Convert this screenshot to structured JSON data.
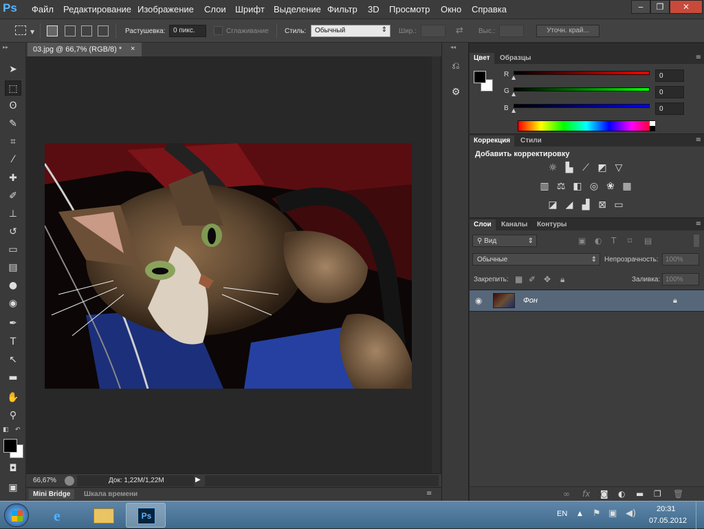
{
  "app": {
    "logo": "Ps"
  },
  "menu": [
    "Файл",
    "Редактирование",
    "Изображение",
    "Слои",
    "Шрифт",
    "Выделение",
    "Фильтр",
    "3D",
    "Просмотр",
    "Окно",
    "Справка"
  ],
  "window_buttons": {
    "minimize": "‒",
    "restore": "❐",
    "close": "✕"
  },
  "options": {
    "feather_label": "Растушевка:",
    "feather_value": "0 пикс.",
    "antialias_label": "Сглаживание",
    "style_label": "Стиль:",
    "style_value": "Обычный",
    "width_label": "Шир.:",
    "height_label": "Выс.:",
    "refine_button": "Уточн. край..."
  },
  "document": {
    "tab_title": "03.jpg @ 66,7% (RGB/8) *",
    "tab_close": "×",
    "zoom": "66,67%",
    "doc_info": "Док: 1,22M/1,22M"
  },
  "bottom_tabs": [
    "Mini Bridge",
    "Шкала времени"
  ],
  "color_panel": {
    "tabs": [
      "Цвет",
      "Образцы"
    ],
    "channels": [
      {
        "label": "R",
        "value": "0",
        "color": "#ff0000"
      },
      {
        "label": "G",
        "value": "0",
        "color": "#00ff00"
      },
      {
        "label": "B",
        "value": "0",
        "color": "#0000ff"
      }
    ]
  },
  "adjustments_panel": {
    "tabs": [
      "Коррекция",
      "Стили"
    ],
    "title": "Добавить корректировку"
  },
  "layers_panel": {
    "tabs": [
      "Слои",
      "Каналы",
      "Контуры"
    ],
    "filter_kind": "Вид",
    "blend_mode": "Обычные",
    "opacity_label": "Непрозрачность:",
    "opacity_value": "100%",
    "lock_label": "Закрепить:",
    "fill_label": "Заливка:",
    "fill_value": "100%",
    "layers": [
      {
        "name": "Фон",
        "locked": true,
        "visible": true
      }
    ]
  },
  "taskbar": {
    "language": "EN",
    "time": "20:31",
    "date": "07.05.2012"
  },
  "colors": {
    "accent": "#5ab4ff",
    "panel": "#3d3d3d",
    "selected_layer": "#57677a"
  }
}
